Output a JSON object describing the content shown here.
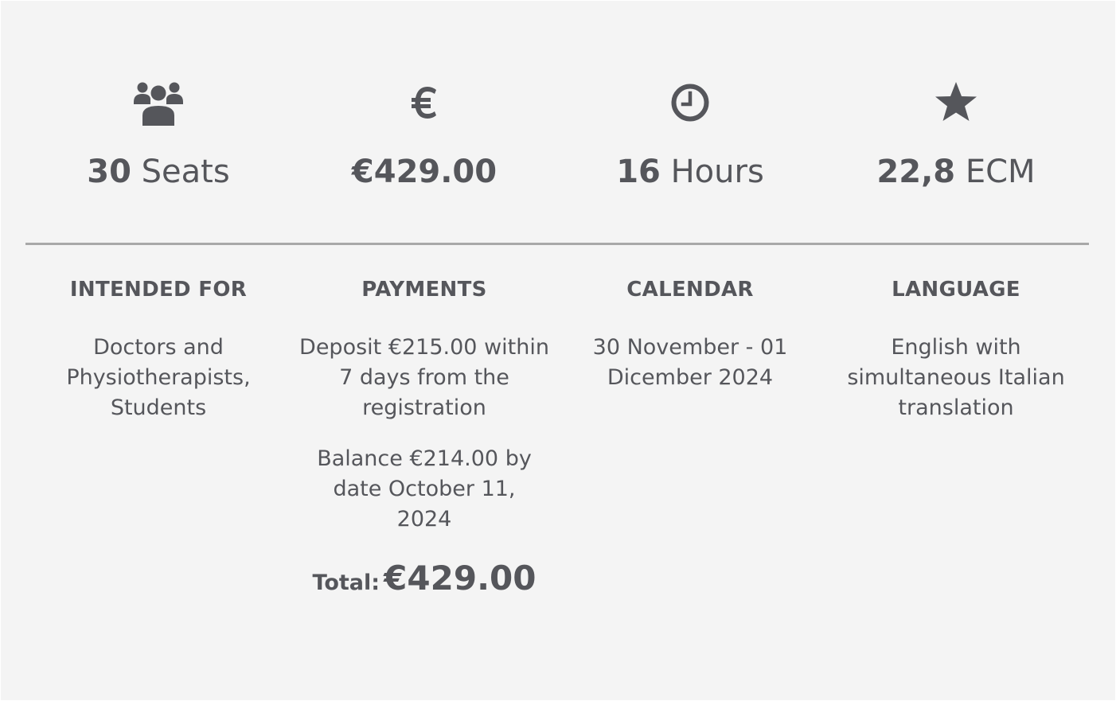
{
  "stats": [
    {
      "icon": "users-icon",
      "value": "30",
      "unit": " Seats"
    },
    {
      "icon": "euro-icon",
      "value": "€429.00",
      "unit": ""
    },
    {
      "icon": "clock-icon",
      "value": "16",
      "unit": " Hours"
    },
    {
      "icon": "star-icon",
      "value": "22,8",
      "unit": " ECM"
    }
  ],
  "intended_for": {
    "heading": "INTENDED FOR",
    "text": "Doctors and Physiotherapists, Students"
  },
  "payments": {
    "heading": "PAYMENTS",
    "deposit": "Deposit €215.00 within 7 days from the registration",
    "balance": "Balance €214.00 by date October 11, 2024",
    "total_label": "Total:",
    "total_amount": "€429.00"
  },
  "calendar": {
    "heading": "CALENDAR",
    "text": "30 November - 01 Dicember 2024"
  },
  "language": {
    "heading": "LANGUAGE",
    "text": "English with simultaneous Italian translation"
  },
  "colors": {
    "background": "#f4f4f4",
    "text": "#55565b",
    "divider": "#a8a8a8"
  }
}
